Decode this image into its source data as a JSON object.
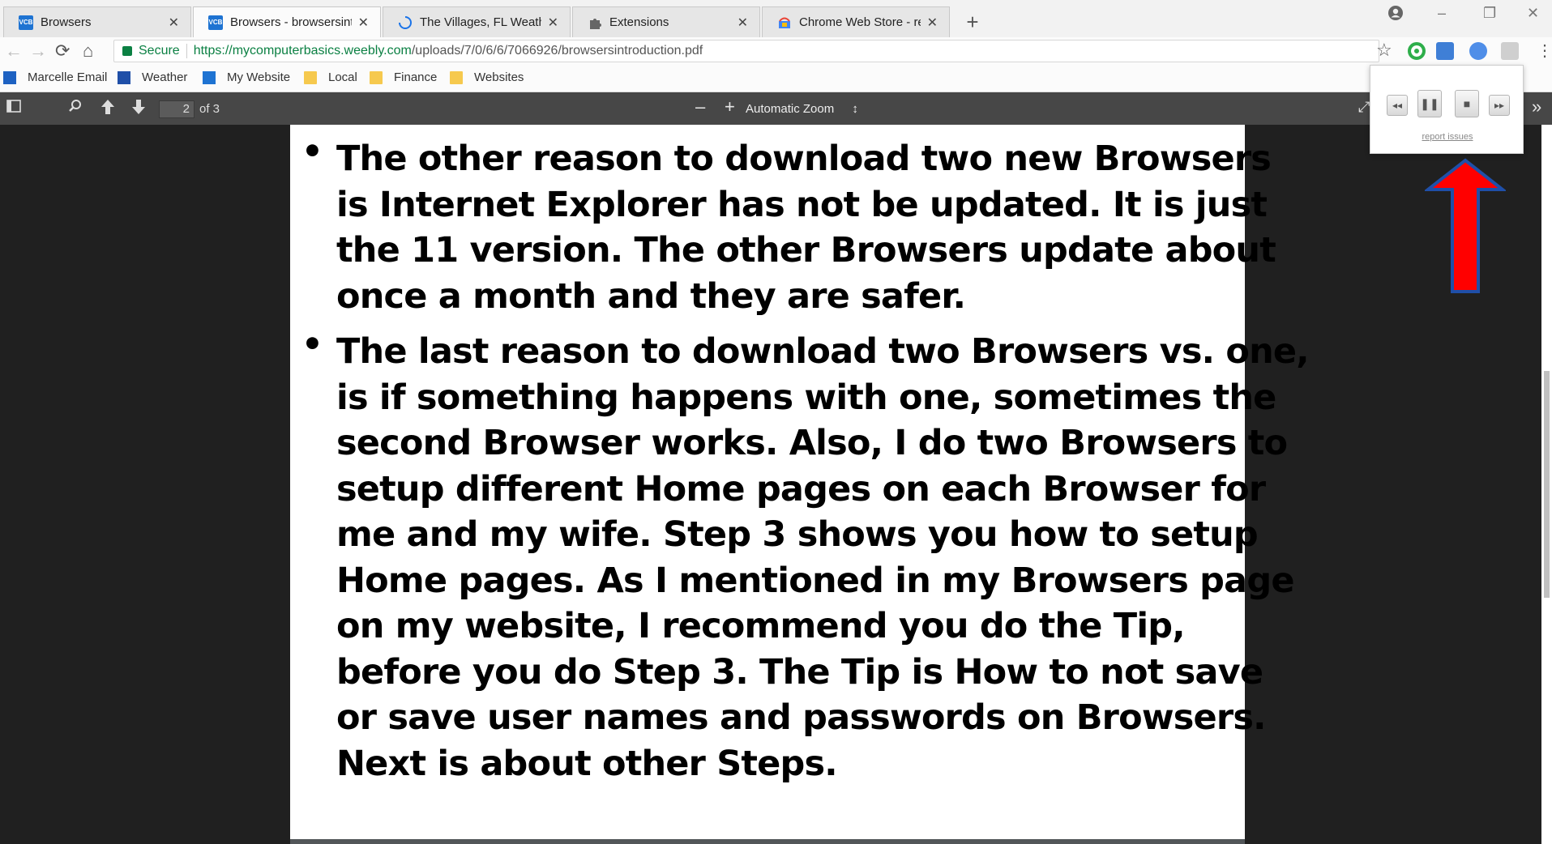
{
  "tabs": [
    {
      "title": "Browsers",
      "favicon": "vcb-icon"
    },
    {
      "title": "Browsers - browsersintro",
      "favicon": "vcb-icon"
    },
    {
      "title": "The Villages, FL Weather",
      "favicon": "loading-icon"
    },
    {
      "title": "Extensions",
      "favicon": "puzzle-icon"
    },
    {
      "title": "Chrome Web Store - reac",
      "favicon": "webstore-icon"
    }
  ],
  "omnibox": {
    "secure_label": "Secure",
    "url_host": "https://mycomputerbasics.weebly.com",
    "url_path": "/uploads/7/0/6/6/7066926/browsersintroduction.pdf"
  },
  "bookmarks": [
    {
      "label": "Marcelle Email",
      "icon": "outlook-icon"
    },
    {
      "label": "Weather",
      "icon": "weather-icon"
    },
    {
      "label": "My Website",
      "icon": "vcb-icon"
    },
    {
      "label": "Local",
      "icon": "folder-icon"
    },
    {
      "label": "Finance",
      "icon": "folder-icon"
    },
    {
      "label": "Websites",
      "icon": "folder-icon"
    }
  ],
  "pdf_toolbar": {
    "page_number": "2",
    "page_count": "of 3",
    "zoom_label": "Automatic Zoom"
  },
  "document": {
    "bullets": [
      {
        "lines": [
          "The other reason to download two new Browsers",
          "is Internet Explorer has not be updated.  It is just",
          "the 11 version.  The other Browsers update about",
          "once a month and they are safer."
        ]
      },
      {
        "lines": [
          "The last reason to download two Browsers vs. one,",
          "is if something happens with one, sometimes the",
          "second Browser works.  Also, I do two Browsers to",
          "setup different Home pages on each Browser for",
          "me and my wife.  Step 3 shows you how to setup",
          "Home pages.  As I mentioned in my Browsers page",
          "on my website, I recommend you do the Tip,",
          "before you do Step 3.  The Tip is How to not save",
          "or save user names and passwords on Browsers.",
          "Next is about other Steps."
        ]
      }
    ]
  },
  "popup": {
    "report_label": "report issues"
  },
  "colors": {
    "pdf_toolbar": "#474747",
    "viewer_bg": "#202020",
    "arrow_fill": "#ff0000",
    "arrow_outline": "#1f4fa8",
    "secure_green": "#0b8043"
  }
}
